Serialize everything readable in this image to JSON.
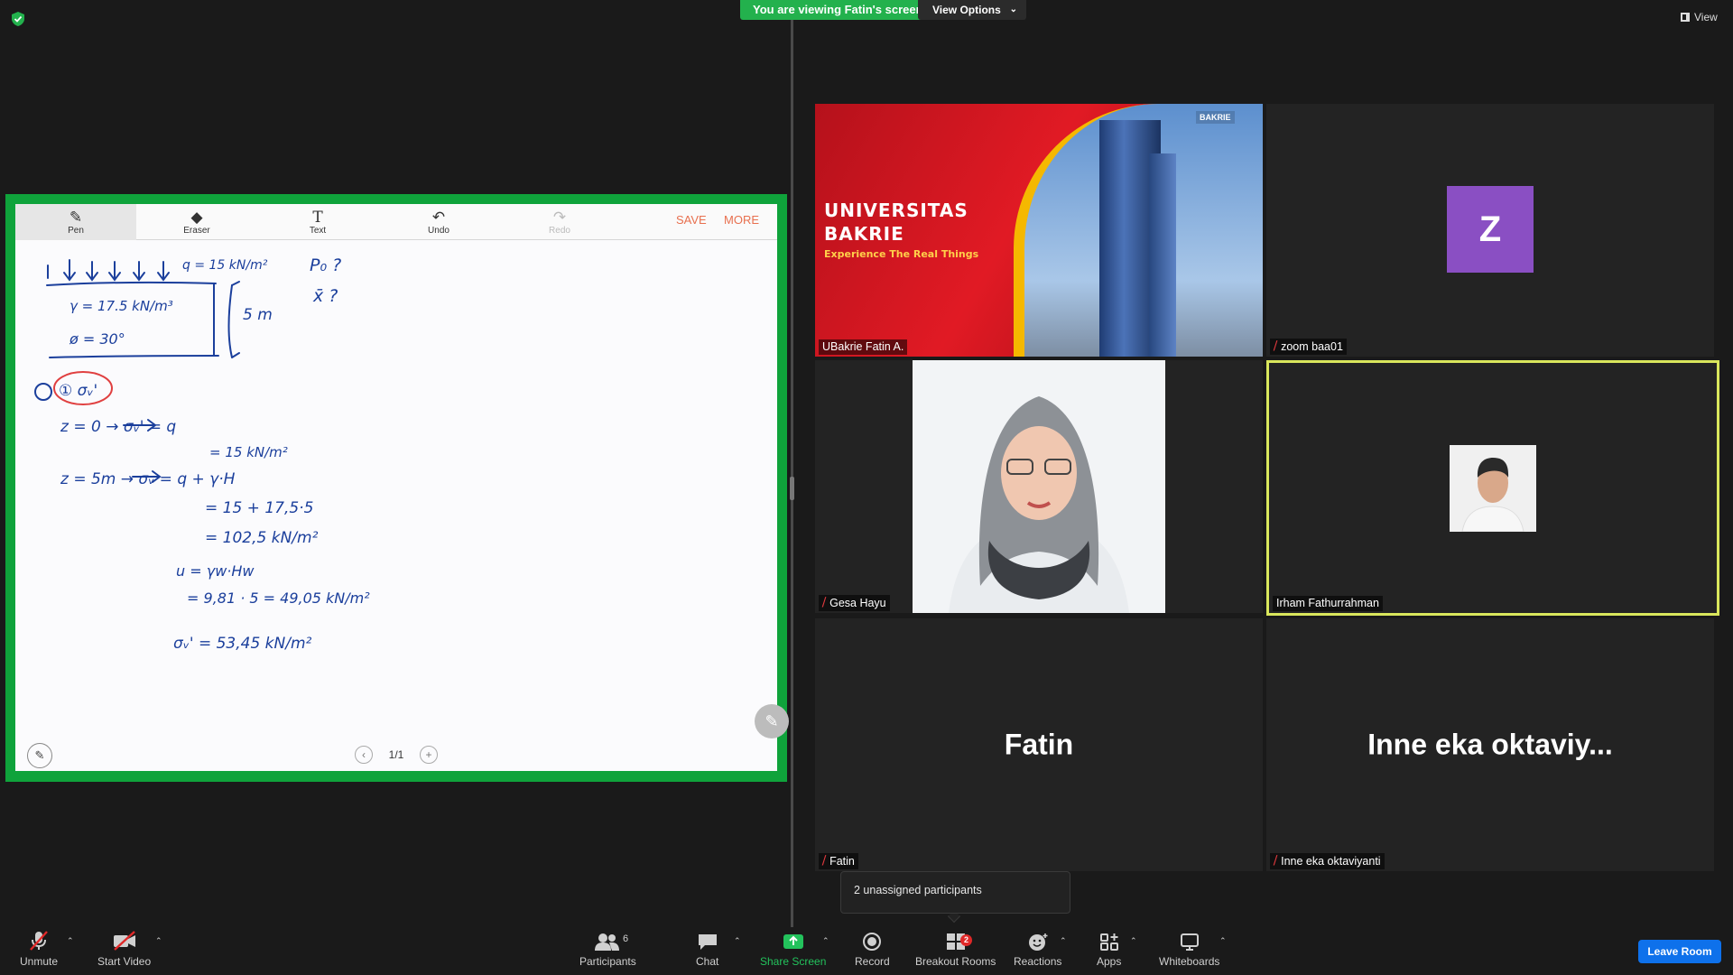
{
  "top_bar": {
    "viewing_banner": "You are viewing Fatin's screen",
    "view_options_label": "View Options",
    "view_label": "View"
  },
  "whiteboard": {
    "tools": [
      {
        "label": "Pen",
        "icon": "pen-icon"
      },
      {
        "label": "Eraser",
        "icon": "eraser-icon"
      },
      {
        "label": "Text",
        "icon": "text-icon"
      },
      {
        "label": "Undo",
        "icon": "undo-icon"
      },
      {
        "label": "Redo",
        "icon": "redo-icon"
      }
    ],
    "save_label": "SAVE",
    "more_label": "MORE",
    "page_indicator": "1/1",
    "handwriting": {
      "line_q": "q = 15 kN/m²",
      "gamma": "γ = 17.5 kN/m³",
      "phi": "ø = 30°",
      "depth": "5 m",
      "p0": "P₀ ?",
      "xbar": "x̄ ?",
      "step1": "① σᵥ'",
      "z0": "z = 0  →  σᵥ' = q",
      "z0_val": "= 15 kN/m²",
      "z5": "z = 5m  →  σᵥ = q + γ·H",
      "z5_a": "= 15 + 17,5·5",
      "z5_b": "= 102,5 kN/m²",
      "u": "u = γw·Hw",
      "u_val": "= 9,81 · 5  = 49,05 kN/m²",
      "result": "σᵥ' = 53,45 kN/m²"
    }
  },
  "participants_tiles": [
    {
      "name": "UBakrie Fatin A.",
      "muted": false
    },
    {
      "name": "zoom baa01",
      "muted": true,
      "avatar_letter": "Z"
    },
    {
      "name": "Gesa Hayu",
      "muted": true
    },
    {
      "name": "Irham Fathurrahman",
      "muted": false,
      "active_speaker": true
    },
    {
      "name": "Fatin",
      "muted": true,
      "display_name": "Fatin"
    },
    {
      "name": "Inne eka oktaviyanti",
      "muted": true,
      "display_name": "Inne eka oktaviy..."
    }
  ],
  "banner": {
    "title_line1": "UNIVERSITAS",
    "title_line2": "BAKRIE",
    "tagline": "Experience The Real Things",
    "logo": "BAKRIE"
  },
  "popup": {
    "unassigned_text": "2 unassigned participants"
  },
  "toolbar": {
    "unmute": "Unmute",
    "start_video": "Start Video",
    "participants": "Participants",
    "participants_count": "6",
    "chat": "Chat",
    "share_screen": "Share Screen",
    "record": "Record",
    "breakout_rooms": "Breakout Rooms",
    "breakout_badge": "2",
    "reactions": "Reactions",
    "apps": "Apps",
    "whiteboards": "Whiteboards",
    "leave_room": "Leave Room"
  },
  "colors": {
    "share_border": "#0fa33b",
    "active_speaker_border": "#d9e65c",
    "accent_blue": "#0e71eb",
    "mute_red": "#e0393e",
    "ink_blue": "#1b3f9c",
    "annotation_red": "#e04040"
  }
}
